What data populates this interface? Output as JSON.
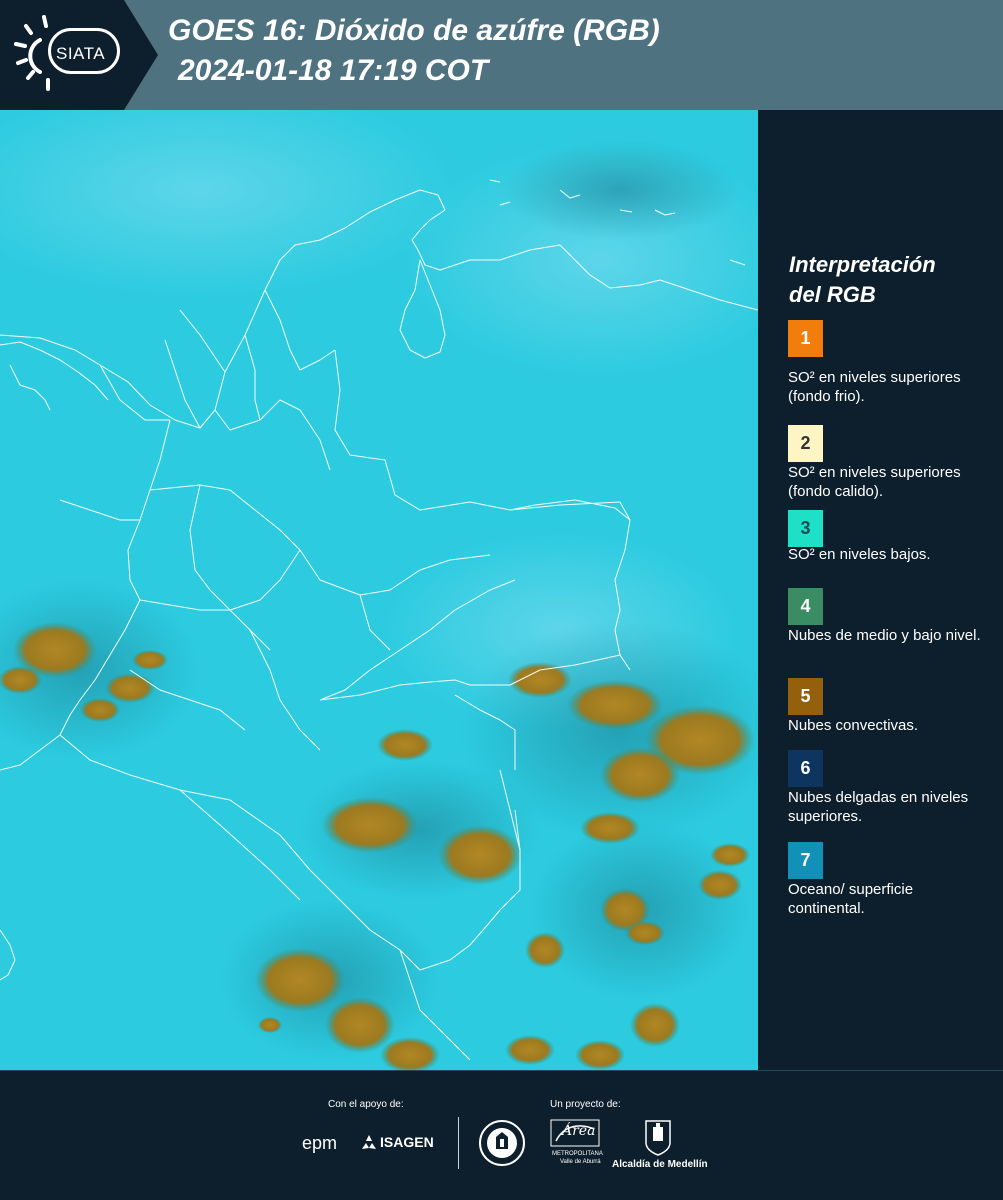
{
  "header": {
    "logo_text": "SIATA",
    "title_line1": "GOES 16: Dióxido de azúfre (RGB)",
    "title_line2": "2024-01-18 17:19 COT"
  },
  "legend": {
    "title_line1": "Interpretación",
    "title_line2": "del RGB",
    "items": [
      {
        "number": "1",
        "color": "#f27d0c",
        "label": "SO² en niveles superiores (fondo frio)."
      },
      {
        "number": "2",
        "color": "#fdf6c4",
        "label": "SO² en niveles superiores (fondo calido)."
      },
      {
        "number": "3",
        "color": "#1de0c6",
        "label": "SO² en niveles bajos."
      },
      {
        "number": "4",
        "color": "#3a8c62",
        "label": "Nubes de medio y bajo nivel."
      },
      {
        "number": "5",
        "color": "#94600c",
        "label": "Nubes convectivas."
      },
      {
        "number": "6",
        "color": "#0d3560",
        "label": "Nubes delgadas en niveles superiores."
      },
      {
        "number": "7",
        "color": "#1190b8",
        "label": "Oceano/ superficie continental."
      }
    ]
  },
  "footer": {
    "support_label": "Con el apoyo de:",
    "project_label": "Un proyecto de:",
    "sponsor_epm": "epm",
    "sponsor_isagen": "ISAGEN",
    "partner_area": "Área",
    "partner_area_sub1": "METROPOLITANA",
    "partner_area_sub2": "Valle de Aburrá",
    "partner_medellin": "Alcaldía de Medellín"
  },
  "colors": {
    "background": "#0d1f2c",
    "header_band": "#4f7281",
    "map_base": "#27c6dc",
    "convective_clouds": "#a17d22",
    "borders": "#ffffff"
  },
  "icons": [
    "sun-logo-icon",
    "cloud-logo-icon",
    "medellin-seal-icon",
    "alcaldia-seal-icon"
  ]
}
